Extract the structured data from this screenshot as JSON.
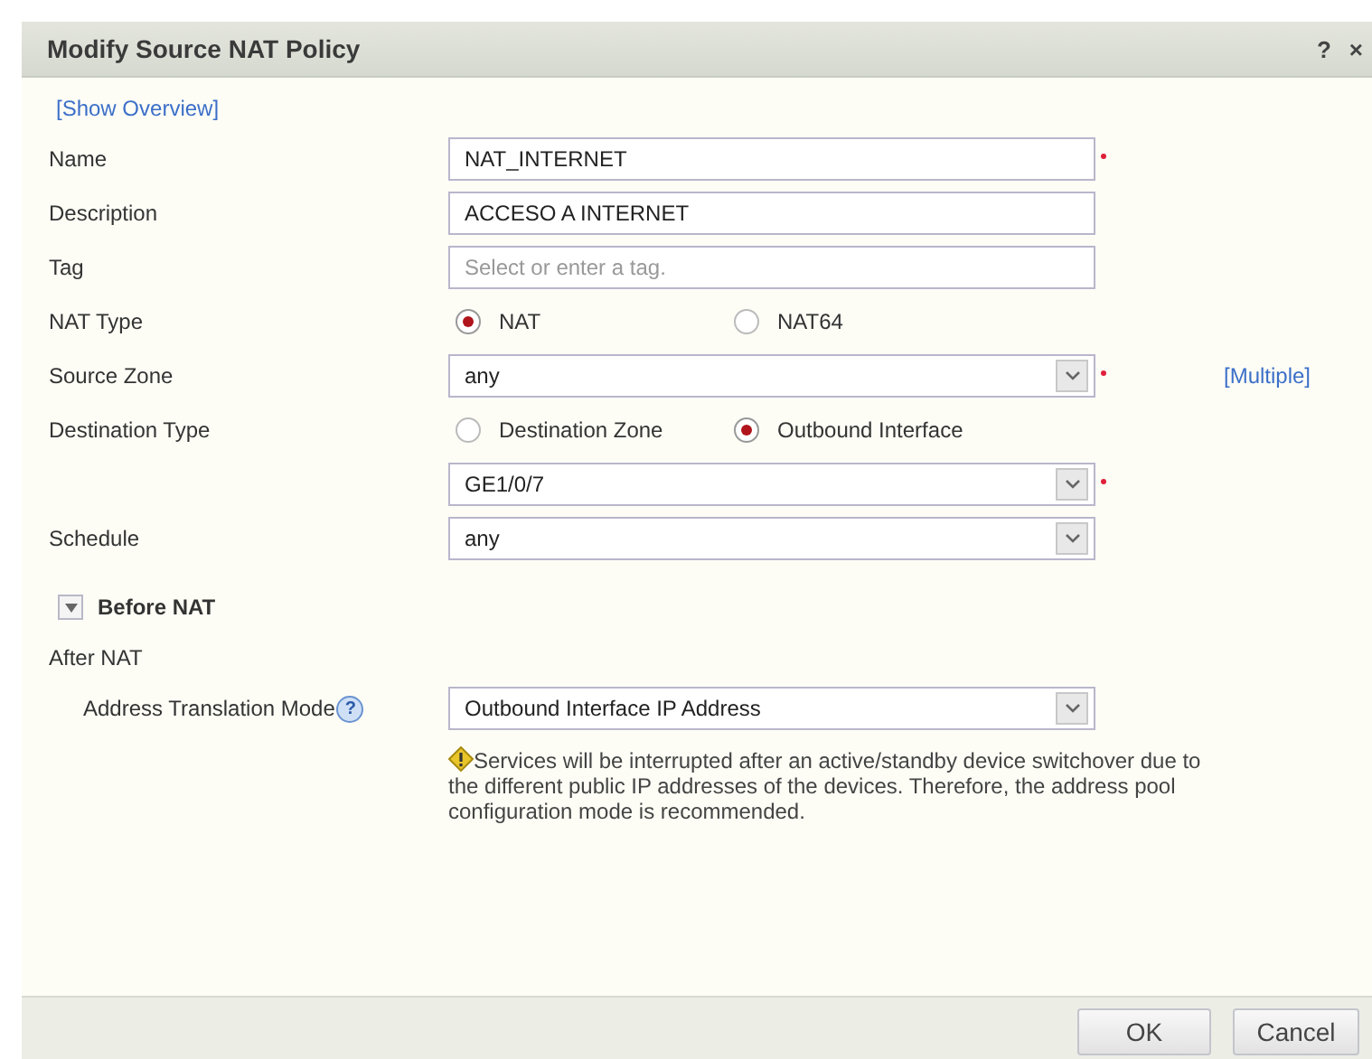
{
  "dialog": {
    "title": "Modify Source NAT Policy",
    "help": "?",
    "close": "×"
  },
  "overview_link": "[Show Overview]",
  "rows": [
    {
      "kind": "text",
      "label": "Name",
      "value": "NAT_INTERNET",
      "required": true
    },
    {
      "kind": "text",
      "label": "Description",
      "value": "ACCESO A INTERNET",
      "required": false
    },
    {
      "kind": "text",
      "label": "Tag",
      "placeholder": "Select or enter a tag.",
      "required": false
    },
    {
      "kind": "radio",
      "label": "NAT Type",
      "options": [
        {
          "label": "NAT",
          "selected": true
        },
        {
          "label": "NAT64",
          "selected": false
        }
      ]
    },
    {
      "kind": "select",
      "label": "Source Zone",
      "value": "any",
      "required": true,
      "link": "[Multiple]"
    },
    {
      "kind": "radio",
      "label": "Destination Type",
      "options": [
        {
          "label": "Destination Zone",
          "selected": false
        },
        {
          "label": "Outbound Interface",
          "selected": true
        }
      ]
    },
    {
      "kind": "select",
      "value": "GE1/0/7",
      "required": true
    },
    {
      "kind": "select",
      "label": "Schedule",
      "value": "any",
      "required": false
    }
  ],
  "before_nat": {
    "label": "Before NAT",
    "expanded": false
  },
  "after_nat": {
    "label": "After NAT",
    "mode_label": "Address Translation Mode",
    "mode_help": "?",
    "mode_value": "Outbound Interface IP Address",
    "warning": "Services will be interrupted after an active/standby device switchover due to the different public IP addresses of the devices. Therefore, the address pool configuration mode is recommended."
  },
  "buttons": [
    "OK",
    "Cancel"
  ]
}
